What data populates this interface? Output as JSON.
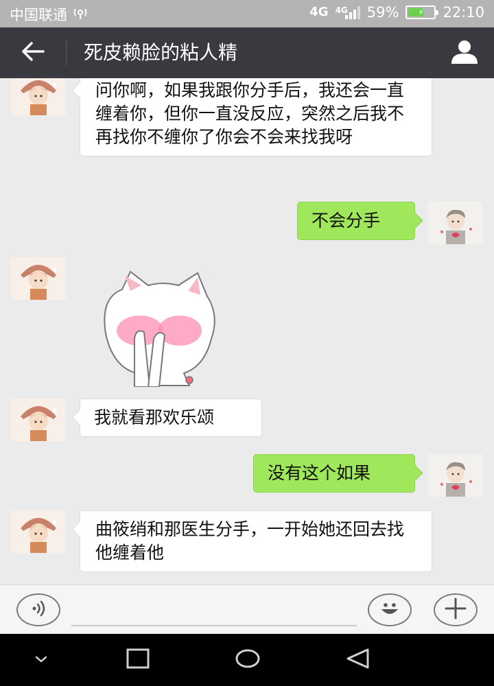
{
  "status_bar": {
    "carrier": "中国联通",
    "network_1": "4G",
    "network_2": "4G",
    "battery_percent": "59%",
    "battery_level": 0.59,
    "time": "22:10"
  },
  "header": {
    "title": "死皮赖脸的粘人精",
    "back_icon": "arrow-left-icon",
    "profile_icon": "person-icon"
  },
  "messages": [
    {
      "side": "left",
      "text": "问你啊，如果我跟你分手后，我还会一直缠着你，但你一直没反应，突然之后我不再找你不缠你了你会不会来找我呀"
    },
    {
      "side": "right",
      "text": "不会分手"
    },
    {
      "side": "left",
      "type": "sticker",
      "sticker": "blushing-cat-sticker"
    },
    {
      "side": "left",
      "text": "我就看那欢乐颂"
    },
    {
      "side": "right",
      "text": "没有这个如果"
    },
    {
      "side": "left",
      "text": "曲筱绡和那医生分手，一开始她还回去找他缠着他"
    }
  ],
  "input_bar": {
    "placeholder": "",
    "voice_icon": "voice-icon",
    "emoji_icon": "emoji-icon",
    "plus_icon": "plus-icon"
  },
  "colors": {
    "title_bar": "#393a3f",
    "status_bar": "#b4b4b4",
    "chat_background": "#ebebeb",
    "sent_bubble": "#9fe75b",
    "received_bubble": "#ffffff"
  }
}
